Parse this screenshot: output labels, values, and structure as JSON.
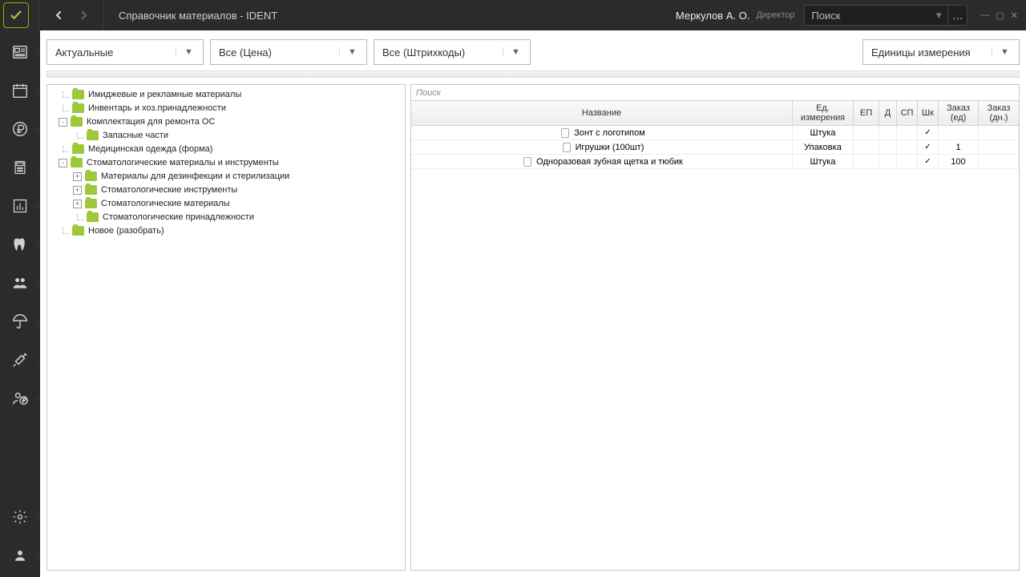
{
  "titlebar": {
    "title": "Справочник материалов  -  IDENT",
    "user": "Меркулов А. О.",
    "role": "Директор",
    "search_placeholder": "Поиск"
  },
  "filters": {
    "actuality": "Актуальные",
    "price": "Все (Цена)",
    "barcode": "Все (Штрихкоды)",
    "units": "Единицы измерения"
  },
  "tree": [
    {
      "level": 1,
      "exp": null,
      "label": "Имиджевые и рекламные материалы"
    },
    {
      "level": 1,
      "exp": null,
      "label": "Инвентарь и хоз.принадлежности"
    },
    {
      "level": 1,
      "exp": "-",
      "label": "Комплектация для ремонта ОС"
    },
    {
      "level": 2,
      "exp": null,
      "label": "Запасные части"
    },
    {
      "level": 1,
      "exp": null,
      "label": "Медицинская одежда (форма)"
    },
    {
      "level": 1,
      "exp": "-",
      "label": "Стоматологические материалы и инструменты"
    },
    {
      "level": 2,
      "exp": "+",
      "label": "Материалы для дезинфекции и стерилизации"
    },
    {
      "level": 2,
      "exp": "+",
      "label": "Стоматологические инструменты"
    },
    {
      "level": 2,
      "exp": "+",
      "label": "Стоматологические материалы"
    },
    {
      "level": 2,
      "exp": null,
      "label": "Стоматологические принадлежности"
    },
    {
      "level": 1,
      "exp": null,
      "label": "Новое (разобрать)"
    }
  ],
  "table": {
    "search_placeholder": "Поиск",
    "headers": {
      "name": "Название",
      "unit": "Ед. измерения",
      "ep": "ЕП",
      "d": "Д",
      "sp": "СП",
      "shk": "Шк",
      "order": "Заказ (ед)",
      "days": "Заказ (дн.)"
    },
    "rows": [
      {
        "name": "Зонт с логотипом",
        "unit": "Штука",
        "ep": "",
        "d": "",
        "sp": "",
        "shk": "✓",
        "order": "",
        "days": ""
      },
      {
        "name": "Игрушки (100шт)",
        "unit": "Упаковка",
        "ep": "",
        "d": "",
        "sp": "",
        "shk": "✓",
        "order": "1",
        "days": ""
      },
      {
        "name": "Одноразовая зубная щетка и тюбик",
        "unit": "Штука",
        "ep": "",
        "d": "",
        "sp": "",
        "shk": "✓",
        "order": "100",
        "days": ""
      }
    ]
  }
}
